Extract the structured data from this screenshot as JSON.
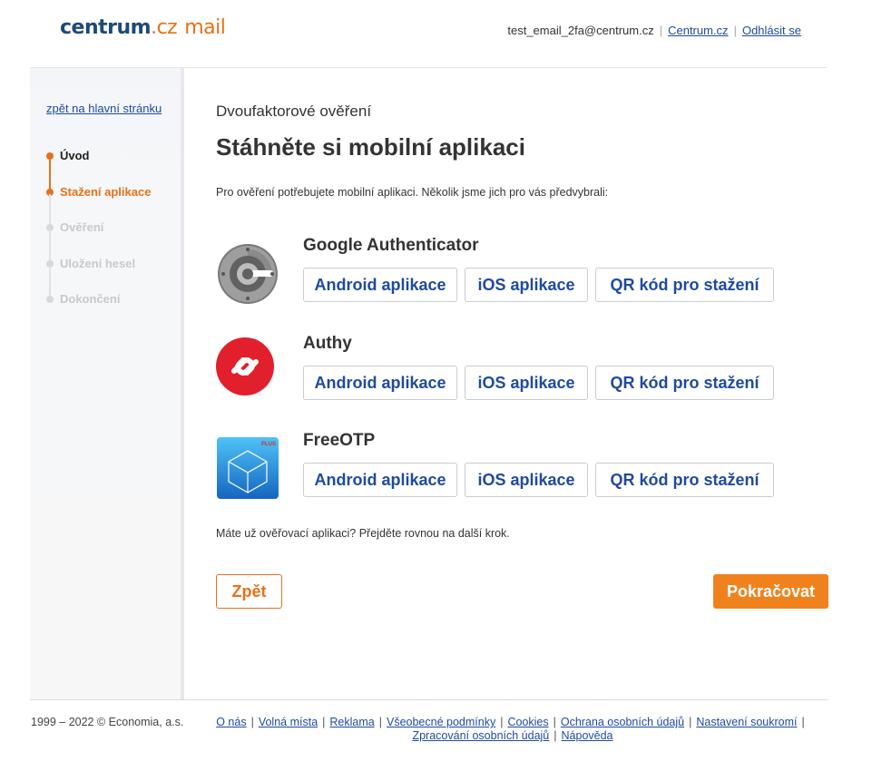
{
  "header": {
    "logo_brand": "centrum",
    "logo_tld": ".cz",
    "logo_product": "mail",
    "user_email": "test_email_2fa@centrum.cz",
    "centrum_link": "Centrum.cz",
    "logout_link": "Odhlásit se"
  },
  "sidebar": {
    "back_link": "zpět na hlavní stránku",
    "steps": [
      {
        "label": "Úvod",
        "state": "done"
      },
      {
        "label": "Stažení aplikace",
        "state": "active"
      },
      {
        "label": "Ověření",
        "state": "pending"
      },
      {
        "label": "Uložení hesel",
        "state": "pending"
      },
      {
        "label": "Dokončení",
        "state": "pending"
      }
    ]
  },
  "main": {
    "subtitle": "Dvoufaktorové ověření",
    "title": "Stáhněte si mobilní aplikaci",
    "intro": "Pro ověření potřebujete mobilní aplikaci. Několik jsme jich pro vás předvybrali:",
    "apps": [
      {
        "name": "Google Authenticator",
        "icon": "google-authenticator-icon",
        "android": "Android aplikace",
        "ios": "iOS aplikace",
        "qr": "QR kód pro stažení"
      },
      {
        "name": "Authy",
        "icon": "authy-icon",
        "android": "Android aplikace",
        "ios": "iOS aplikace",
        "qr": "QR kód pro stažení"
      },
      {
        "name": "FreeOTP",
        "icon": "freeotp-icon",
        "icon_badge": "PLUS",
        "android": "Android aplikace",
        "ios": "iOS aplikace",
        "qr": "QR kód pro stažení"
      }
    ],
    "hint": "Máte už ověřovací aplikaci? Přejděte rovnou na další krok.",
    "back_button": "Zpět",
    "next_button": "Pokračovat"
  },
  "footer": {
    "copyright": "1999 – 2022 © Economia, a.s.",
    "links": [
      "O nás",
      "Volná místa",
      "Reklama",
      "Všeobecné podmínky",
      "Cookies",
      "Ochrana osobních údajů",
      "Nastavení soukromí",
      "Zpracování osobních údajů",
      "Nápověda"
    ]
  },
  "colors": {
    "accent": "#e8701a",
    "link": "#1e4a9e",
    "brand": "#1e4a75",
    "authy_red": "#e21f2d",
    "freeotp_blue": "#2a8fe0"
  }
}
